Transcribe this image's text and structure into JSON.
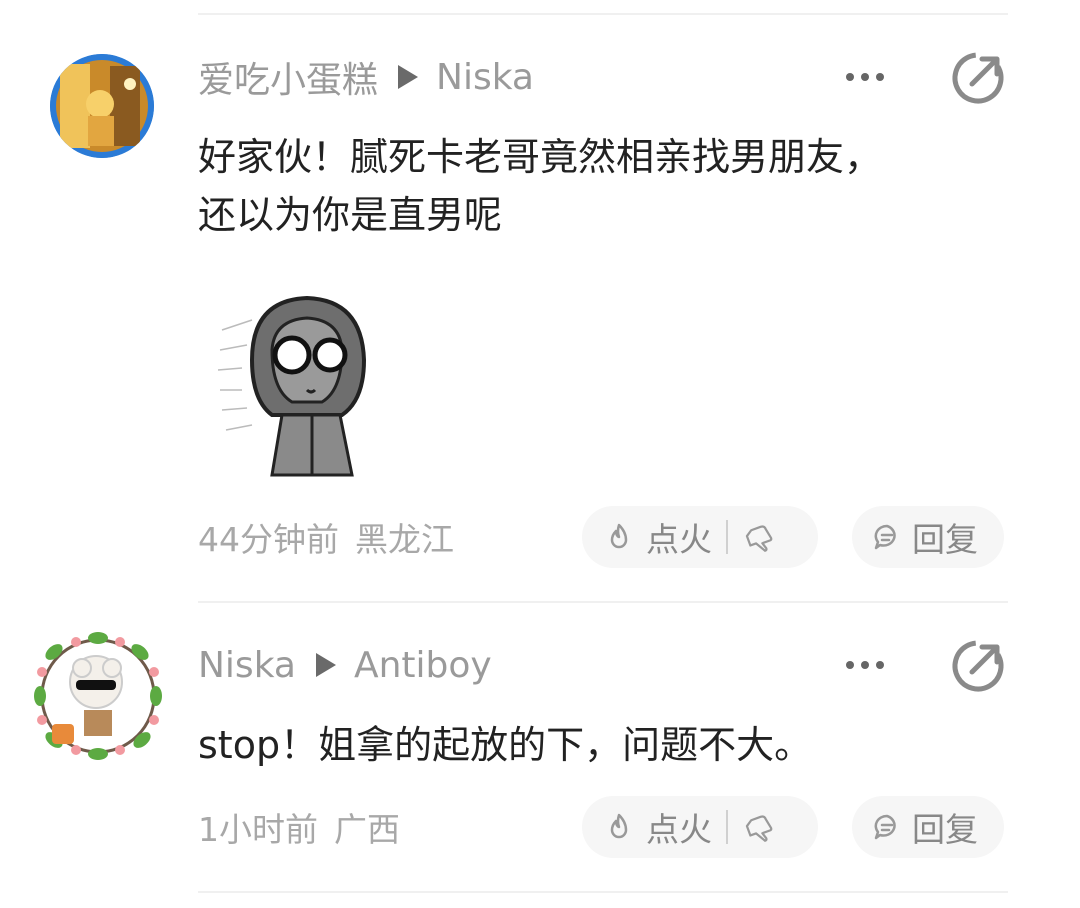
{
  "comments": [
    {
      "author": "爱吃小蛋糕",
      "reply_to": "Niska",
      "lines": [
        "好家伙！腻死卡老哥竟然相亲找男朋友，",
        "还以为你是直男呢"
      ],
      "time": "44分钟前",
      "location": "黑龙江",
      "like_label": "点火",
      "reply_label": "回复"
    },
    {
      "author": "Niska",
      "reply_to": "Antiboy",
      "lines": [
        "stop！姐拿的起放的下，问题不大。"
      ],
      "time": "1小时前",
      "location": "广西",
      "like_label": "点火",
      "reply_label": "回复"
    }
  ],
  "icons": {
    "more": "more-dots-icon",
    "share": "share-arrow-icon",
    "fire": "fire-icon",
    "thumb": "thumbs-down-icon",
    "reply": "reply-bubble-icon"
  },
  "colors": {
    "avatar1_ring": "#2b7bd6",
    "text_primary": "#222222",
    "text_secondary": "#9a9a9a",
    "pill_bg": "#f6f6f6"
  }
}
